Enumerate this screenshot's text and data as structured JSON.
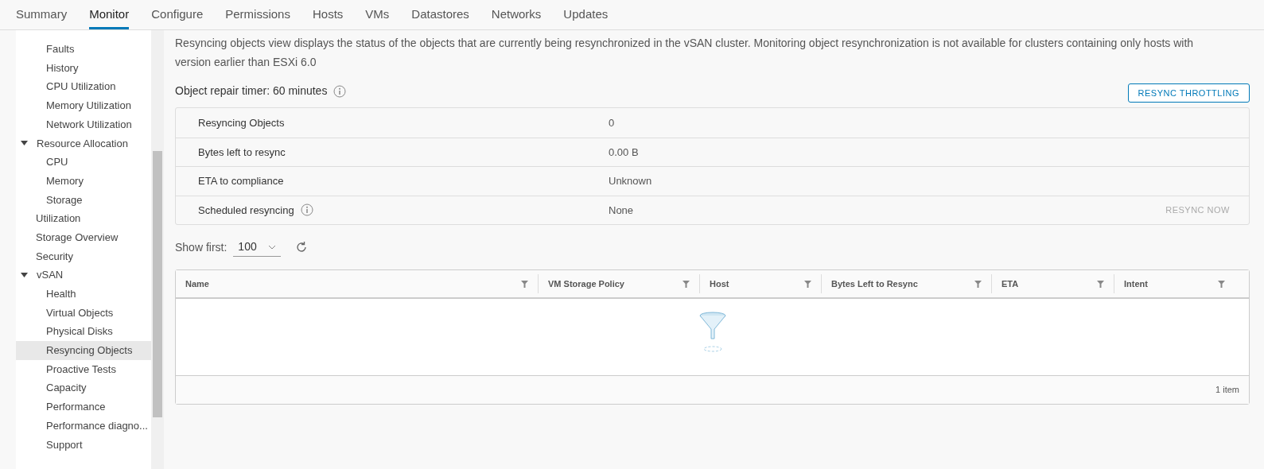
{
  "tabs": [
    {
      "label": "Summary",
      "selected": false
    },
    {
      "label": "Monitor",
      "selected": true
    },
    {
      "label": "Configure",
      "selected": false
    },
    {
      "label": "Permissions",
      "selected": false
    },
    {
      "label": "Hosts",
      "selected": false
    },
    {
      "label": "VMs",
      "selected": false
    },
    {
      "label": "Datastores",
      "selected": false
    },
    {
      "label": "Networks",
      "selected": false
    },
    {
      "label": "Updates",
      "selected": false
    }
  ],
  "sidebar": {
    "continued_items": [
      {
        "label": "Faults",
        "selected": false
      },
      {
        "label": "History",
        "selected": false
      },
      {
        "label": "CPU Utilization",
        "selected": false
      },
      {
        "label": "Memory Utilization",
        "selected": false
      },
      {
        "label": "Network Utilization",
        "selected": false
      }
    ],
    "items": [
      {
        "label": "Resource Allocation",
        "selected": false,
        "expanded": true,
        "children": [
          {
            "label": "CPU",
            "selected": false
          },
          {
            "label": "Memory",
            "selected": false
          },
          {
            "label": "Storage",
            "selected": false
          }
        ]
      },
      {
        "label": "Utilization",
        "selected": false
      },
      {
        "label": "Storage Overview",
        "selected": false
      },
      {
        "label": "Security",
        "selected": false
      },
      {
        "label": "vSAN",
        "selected": false,
        "expanded": true,
        "children": [
          {
            "label": "Health",
            "selected": false
          },
          {
            "label": "Virtual Objects",
            "selected": false
          },
          {
            "label": "Physical Disks",
            "selected": false
          },
          {
            "label": "Resyncing Objects",
            "selected": true
          },
          {
            "label": "Proactive Tests",
            "selected": false
          },
          {
            "label": "Capacity",
            "selected": false
          },
          {
            "label": "Performance",
            "selected": false
          },
          {
            "label": "Performance diagno...",
            "selected": false
          },
          {
            "label": "Support",
            "selected": false
          }
        ]
      }
    ]
  },
  "description": "Resyncing objects view displays the status of the objects that are currently being resynchronized in the vSAN cluster. Monitoring object resynchronization is not available for clusters containing only hosts with version earlier than ESXi 6.0",
  "repair_timer": "Object repair timer: 60 minutes",
  "throttling_button": "RESYNC THROTTLING",
  "summary": [
    {
      "label": "Resyncing Objects",
      "value": "0",
      "info": false
    },
    {
      "label": "Bytes left to resync",
      "value": "0.00 B",
      "info": false
    },
    {
      "label": "ETA to compliance",
      "value": "Unknown",
      "info": false
    },
    {
      "label": "Scheduled resyncing",
      "value": "None",
      "info": true,
      "action": "RESYNC NOW",
      "action_disabled": true
    }
  ],
  "show_first": {
    "label": "Show first:",
    "value": "100"
  },
  "table": {
    "columns": [
      "Name",
      "VM Storage Policy",
      "Host",
      "Bytes Left to Resync",
      "ETA",
      "Intent"
    ],
    "footer": "1 item"
  }
}
